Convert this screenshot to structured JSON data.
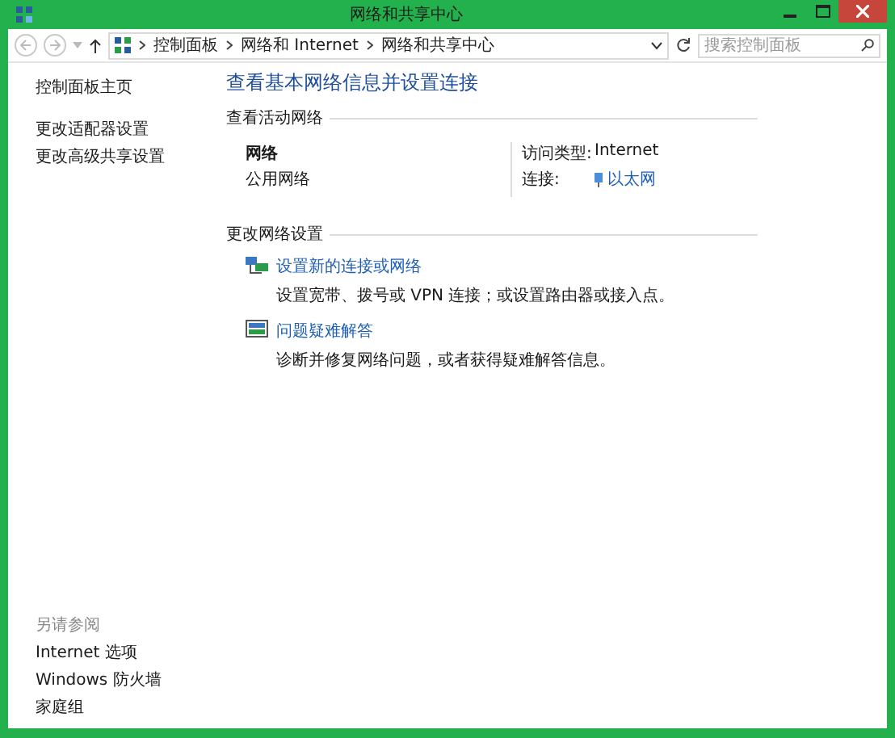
{
  "window": {
    "title": "网络和共享中心"
  },
  "address_bar": {
    "breadcrumbs": [
      "控制面板",
      "网络和 Internet",
      "网络和共享中心"
    ]
  },
  "search": {
    "placeholder": "搜索控制面板"
  },
  "sidebar": {
    "items": [
      "控制面板主页",
      "更改适配器设置",
      "更改高级共享设置"
    ],
    "see_also": {
      "heading": "另请参阅",
      "items": [
        "Internet 选项",
        "Windows 防火墙",
        "家庭组"
      ]
    }
  },
  "main": {
    "title": "查看基本网络信息并设置连接",
    "active_networks": {
      "heading": "查看活动网络",
      "network_name": "网络",
      "network_type": "公用网络",
      "access_type_label": "访问类型:",
      "access_type": "Internet",
      "connection_label": "连接:",
      "connection": "以太网"
    },
    "change_settings": {
      "heading": "更改网络设置",
      "tasks": [
        {
          "kind": "setup",
          "link": "设置新的连接或网络",
          "description": "设置宽带、拨号或 VPN 连接；或设置路由器或接入点。"
        },
        {
          "kind": "troubleshoot",
          "link": "问题疑难解答",
          "description": "诊断并修复网络问题，或者获得疑难解答信息。"
        }
      ]
    }
  }
}
